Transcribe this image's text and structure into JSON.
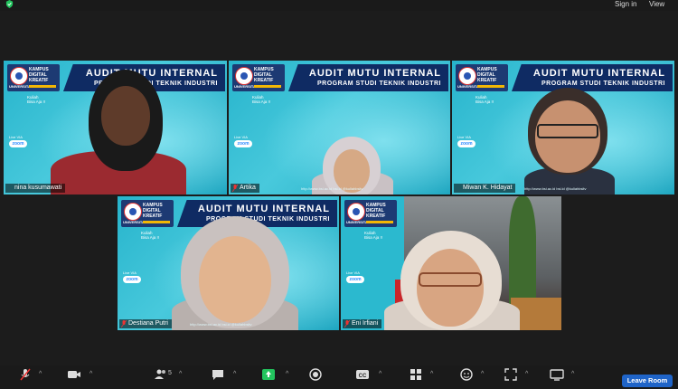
{
  "topbar": {
    "sign_in": "Sign in",
    "view": "View"
  },
  "slide": {
    "brand_line1": "KAMPUS",
    "brand_line2": "DIGITAL",
    "brand_line3": "KREATIF",
    "brand_univ": "UNIVERSITAS",
    "title": "AUDIT MUTU INTERNAL",
    "subtitle": "PROGRAM STUDI TEKNIK INDUSTRI",
    "kuliah": "Kuliah",
    "kuliah2": "Bisa Aja !!",
    "live_via": "Live VIA",
    "zoom": "zoom",
    "footer": "http://www.bsi.ac.id    bsi.id    @kuliahbsitv"
  },
  "participants": [
    {
      "name": "nina kusumawati",
      "active": true
    },
    {
      "name": "Artika",
      "active": false
    },
    {
      "name": "Miwan K. Hidayat",
      "active": false
    },
    {
      "name": "Destiana Putri",
      "active": false
    },
    {
      "name": "Eni Irfiani",
      "active": false
    }
  ],
  "toolbar": {
    "participants_count": "5",
    "leave_label": "Leave Room"
  },
  "colors": {
    "active_border": "#c8e64b",
    "leave": "#1f64c8",
    "share": "#22c55e",
    "slide_bg": "#2bb9cf"
  }
}
